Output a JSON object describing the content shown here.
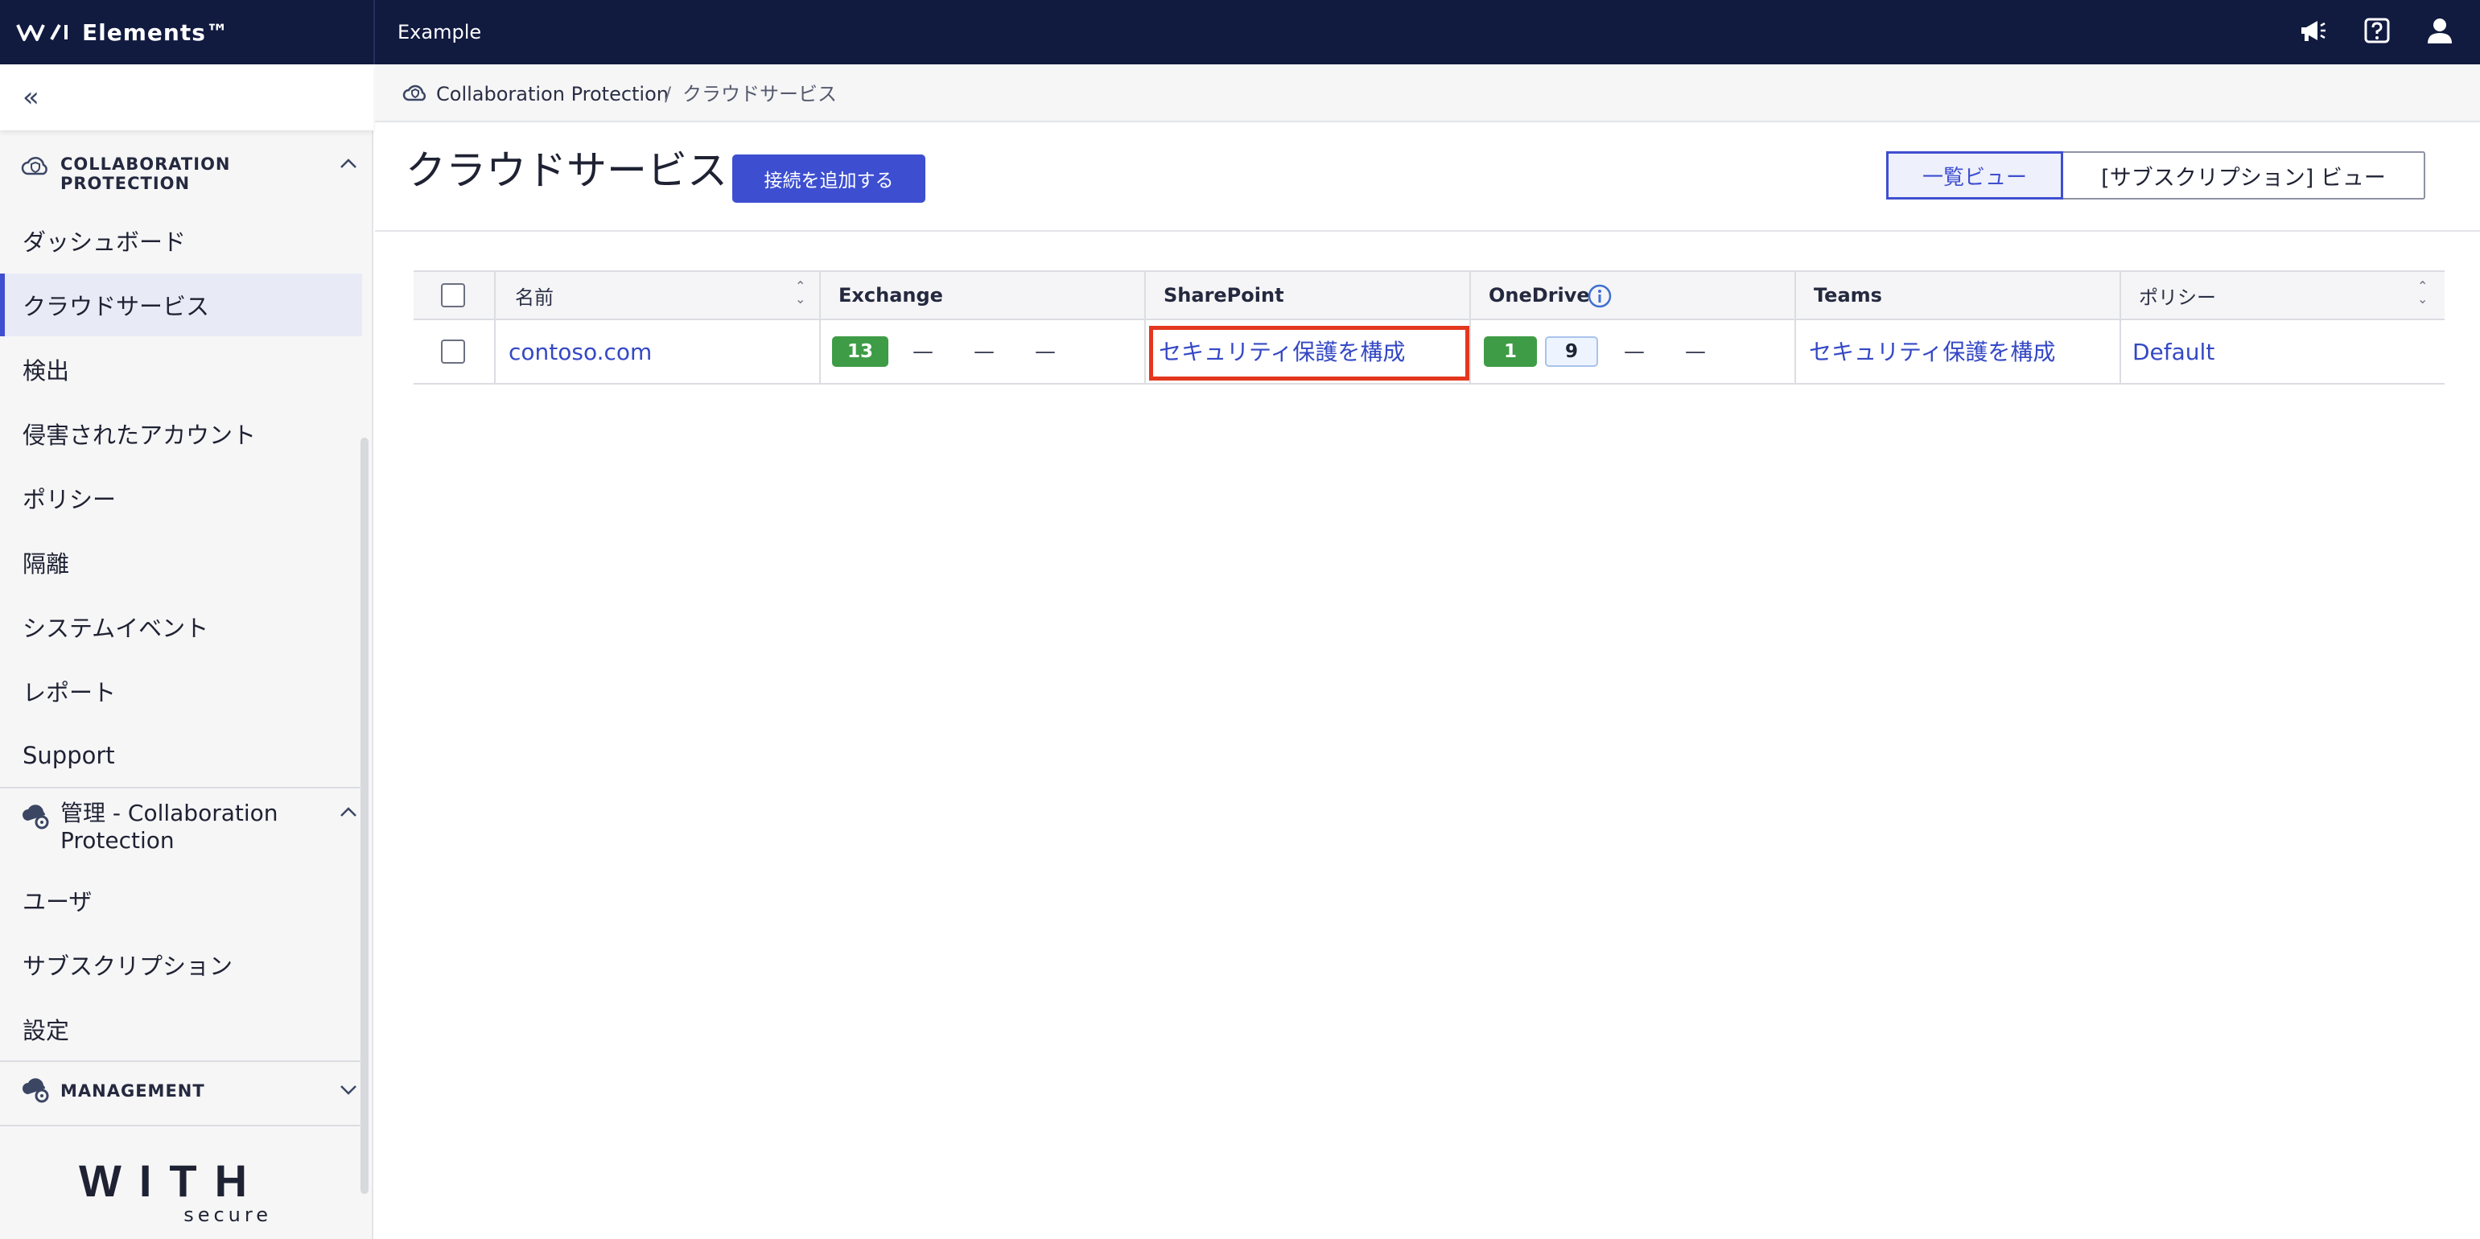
{
  "topbar": {
    "brand": "Elements™",
    "org": "Example",
    "icons": [
      "announcement-icon",
      "help-icon",
      "user-icon"
    ]
  },
  "sidebar": {
    "collapse_icon": "double-chevron-left-icon",
    "section_collab": {
      "title_line1": "COLLABORATION",
      "title_line2": "PROTECTION",
      "items": [
        {
          "label": "ダッシュボード"
        },
        {
          "label": "クラウドサービス",
          "active": true
        },
        {
          "label": "検出"
        },
        {
          "label": "侵害されたアカウント"
        },
        {
          "label": "ポリシー"
        },
        {
          "label": "隔離"
        },
        {
          "label": "システムイベント"
        },
        {
          "label": "レポート"
        },
        {
          "label": "Support"
        }
      ]
    },
    "section_admin": {
      "title_line1": "管理 - Collaboration",
      "title_line2": "Protection",
      "items": [
        {
          "label": "ユーザ"
        },
        {
          "label": "サブスクリプション"
        },
        {
          "label": "設定"
        }
      ]
    },
    "section_management": {
      "title": "MANAGEMENT"
    },
    "footer_logo_word": "WITH",
    "footer_logo_sub": "secure"
  },
  "breadcrumb": {
    "root": "Collaboration Protection",
    "separator": "/",
    "current": "クラウドサービス"
  },
  "page": {
    "title": "クラウドサービス",
    "add_button": "接続を追加する",
    "view_list": "一覧ビュー",
    "view_subscription": "[サブスクリプション] ビュー"
  },
  "table": {
    "headers": {
      "name": "名前",
      "exchange": "Exchange",
      "sharepoint": "SharePoint",
      "onedrive": "OneDrive",
      "teams": "Teams",
      "policy": "ポリシー"
    },
    "rows": [
      {
        "name": "contoso.com",
        "exchange_badge": "13",
        "exchange_dashes": [
          "—",
          "—",
          "—"
        ],
        "sharepoint": "セキュリティ保護を構成",
        "onedrive_badge_green": "1",
        "onedrive_badge_outline": "9",
        "onedrive_dashes": [
          "—",
          "—"
        ],
        "teams": "セキュリティ保護を構成",
        "policy": "Default"
      }
    ]
  },
  "colors": {
    "topbar": "#111a3f",
    "accent": "#3d4fd0",
    "success": "#3e9c46",
    "highlight": "#e3371e",
    "link": "#3448c5"
  }
}
